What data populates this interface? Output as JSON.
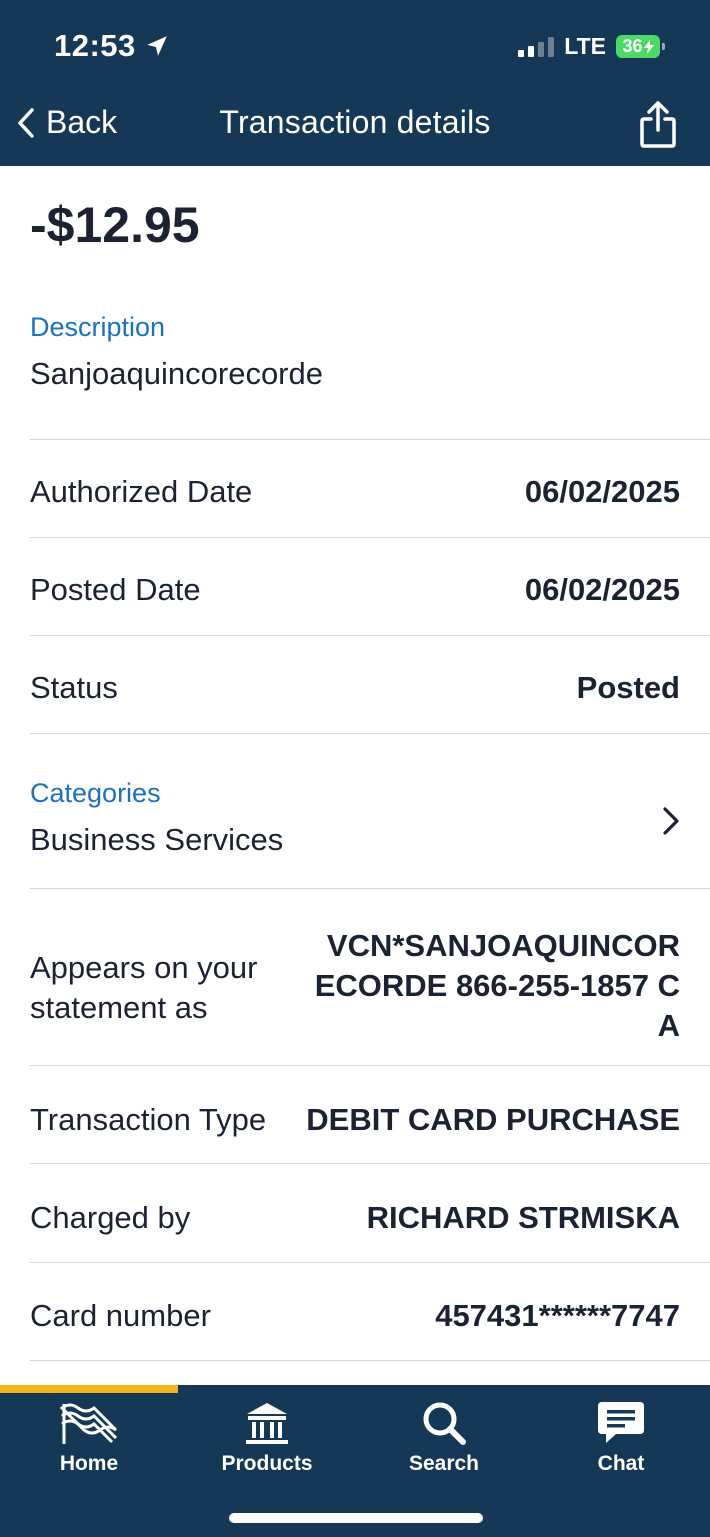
{
  "status_bar": {
    "time": "12:53",
    "network": "LTE",
    "battery": "36"
  },
  "nav": {
    "back_label": "Back",
    "title": "Transaction details"
  },
  "transaction": {
    "amount": "-$12.95",
    "description_label": "Description",
    "description_value": "Sanjoaquincorecorde",
    "authorized_date_label": "Authorized Date",
    "authorized_date_value": "06/02/2025",
    "posted_date_label": "Posted Date",
    "posted_date_value": "06/02/2025",
    "status_label": "Status",
    "status_value": "Posted",
    "categories_label": "Categories",
    "categories_value": "Business Services",
    "statement_label": "Appears on your statement as",
    "statement_value": "VCN*SANJOAQUINCORECORDE  866-255-1857 CA",
    "transaction_type_label": "Transaction Type",
    "transaction_type_value": "DEBIT CARD PURCHASE",
    "charged_by_label": "Charged by",
    "charged_by_value": "RICHARD STRMISKA",
    "card_number_label": "Card number",
    "card_number_value": "457431******7747"
  },
  "tabs": [
    {
      "label": "Home",
      "icon": "home-flag-icon",
      "active": true
    },
    {
      "label": "Products",
      "icon": "bank-building-icon",
      "active": false
    },
    {
      "label": "Search",
      "icon": "search-icon",
      "active": false
    },
    {
      "label": "Chat",
      "icon": "chat-bubble-icon",
      "active": false
    }
  ],
  "colors": {
    "header_bg": "#163857",
    "accent_blue": "#1a72c2",
    "tab_indicator": "#f2b51d",
    "battery_green": "#4cd964"
  }
}
